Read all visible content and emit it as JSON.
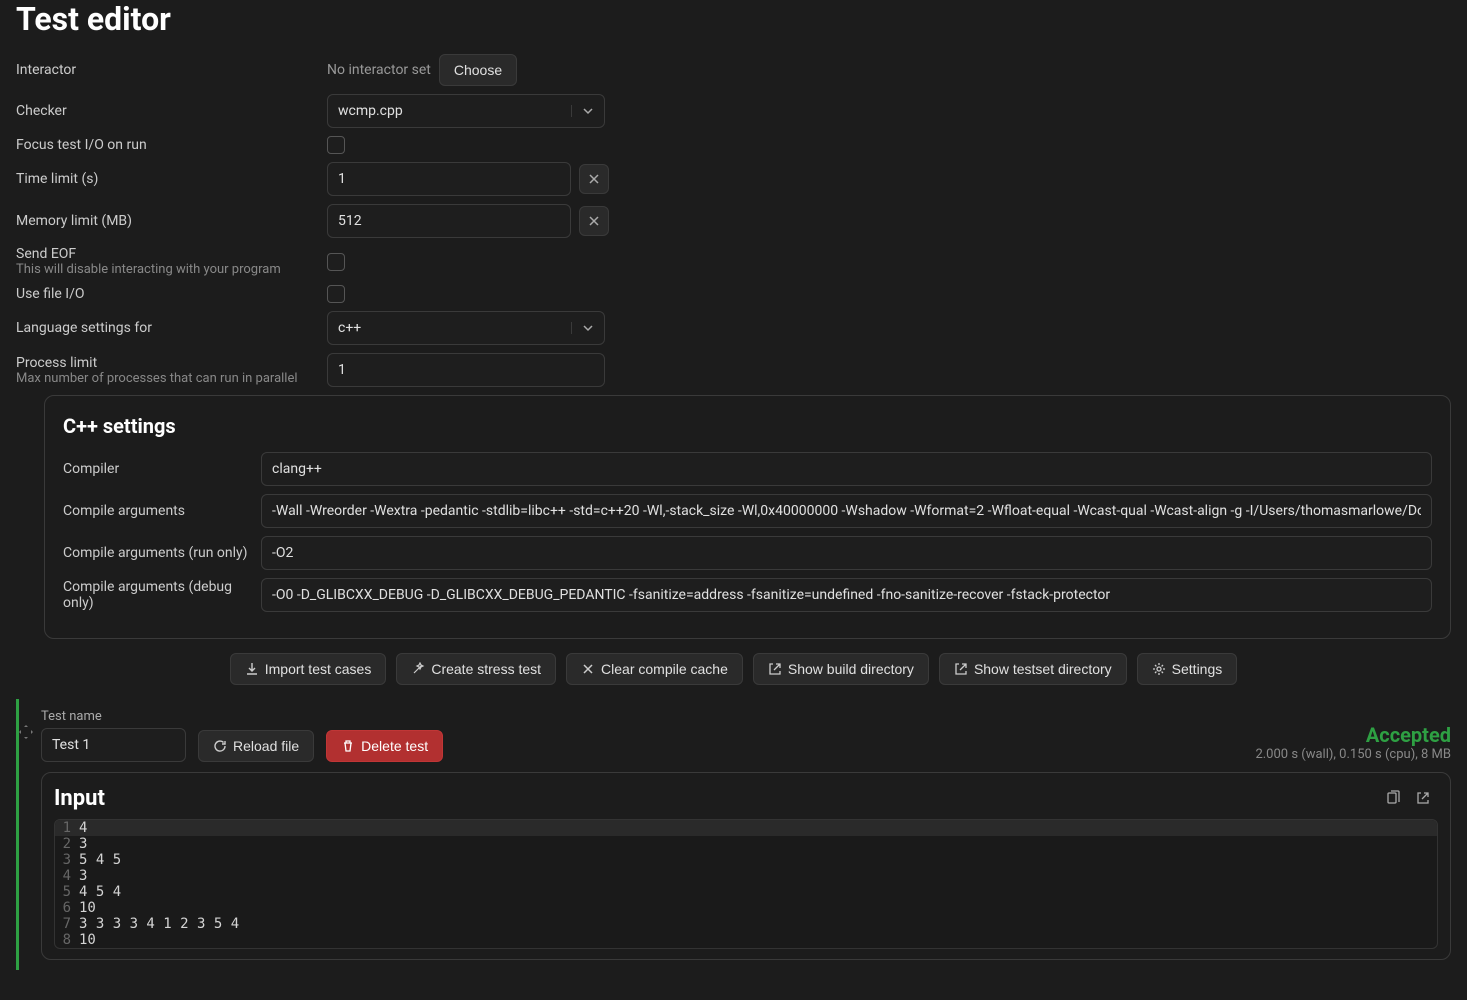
{
  "page_title": "Test editor",
  "form": {
    "interactor_label": "Interactor",
    "interactor_value": "No interactor set",
    "interactor_choose": "Choose",
    "checker_label": "Checker",
    "checker_value": "wcmp.cpp",
    "focus_label": "Focus test I/O on run",
    "time_label": "Time limit (s)",
    "time_value": "1",
    "memory_label": "Memory limit (MB)",
    "memory_value": "512",
    "eof_label": "Send EOF",
    "eof_sub": "This will disable interacting with your program",
    "usefile_label": "Use file I/O",
    "lang_label": "Language settings for",
    "lang_value": "c++",
    "process_label": "Process limit",
    "process_sub": "Max number of processes that can run in parallel",
    "process_value": "1"
  },
  "cpp": {
    "heading": "C++ settings",
    "compiler_label": "Compiler",
    "compiler_value": "clang++",
    "args_label": "Compile arguments",
    "args_value": "-Wall -Wreorder -Wextra -pedantic -stdlib=libc++ -std=c++20 -Wl,-stack_size -Wl,0x40000000 -Wshadow -Wformat=2 -Wfloat-equal -Wcast-qual -Wcast-align -g -I/Users/thomasmarlowe/Doc",
    "run_label": "Compile arguments (run only)",
    "run_value": "-O2",
    "debug_label": "Compile arguments (debug only)",
    "debug_value": "-O0 -D_GLIBCXX_DEBUG -D_GLIBCXX_DEBUG_PEDANTIC -fsanitize=address -fsanitize=undefined -fno-sanitize-recover -fstack-protector"
  },
  "actions": {
    "import": "Import test cases",
    "stress": "Create stress test",
    "clear": "Clear compile cache",
    "build_dir": "Show build directory",
    "testset_dir": "Show testset directory",
    "settings": "Settings"
  },
  "test": {
    "name_label": "Test name",
    "name_value": "Test 1",
    "reload": "Reload file",
    "delete": "Delete test",
    "status": "Accepted",
    "meta": "2.000 s (wall), 0.150 s (cpu), 8 MB"
  },
  "input": {
    "heading": "Input",
    "lines": [
      "4",
      "3",
      "5 4 5",
      "3",
      "4 5 4",
      "10",
      "3 3 3 3 4 1 2 3 5 4",
      "10"
    ]
  }
}
